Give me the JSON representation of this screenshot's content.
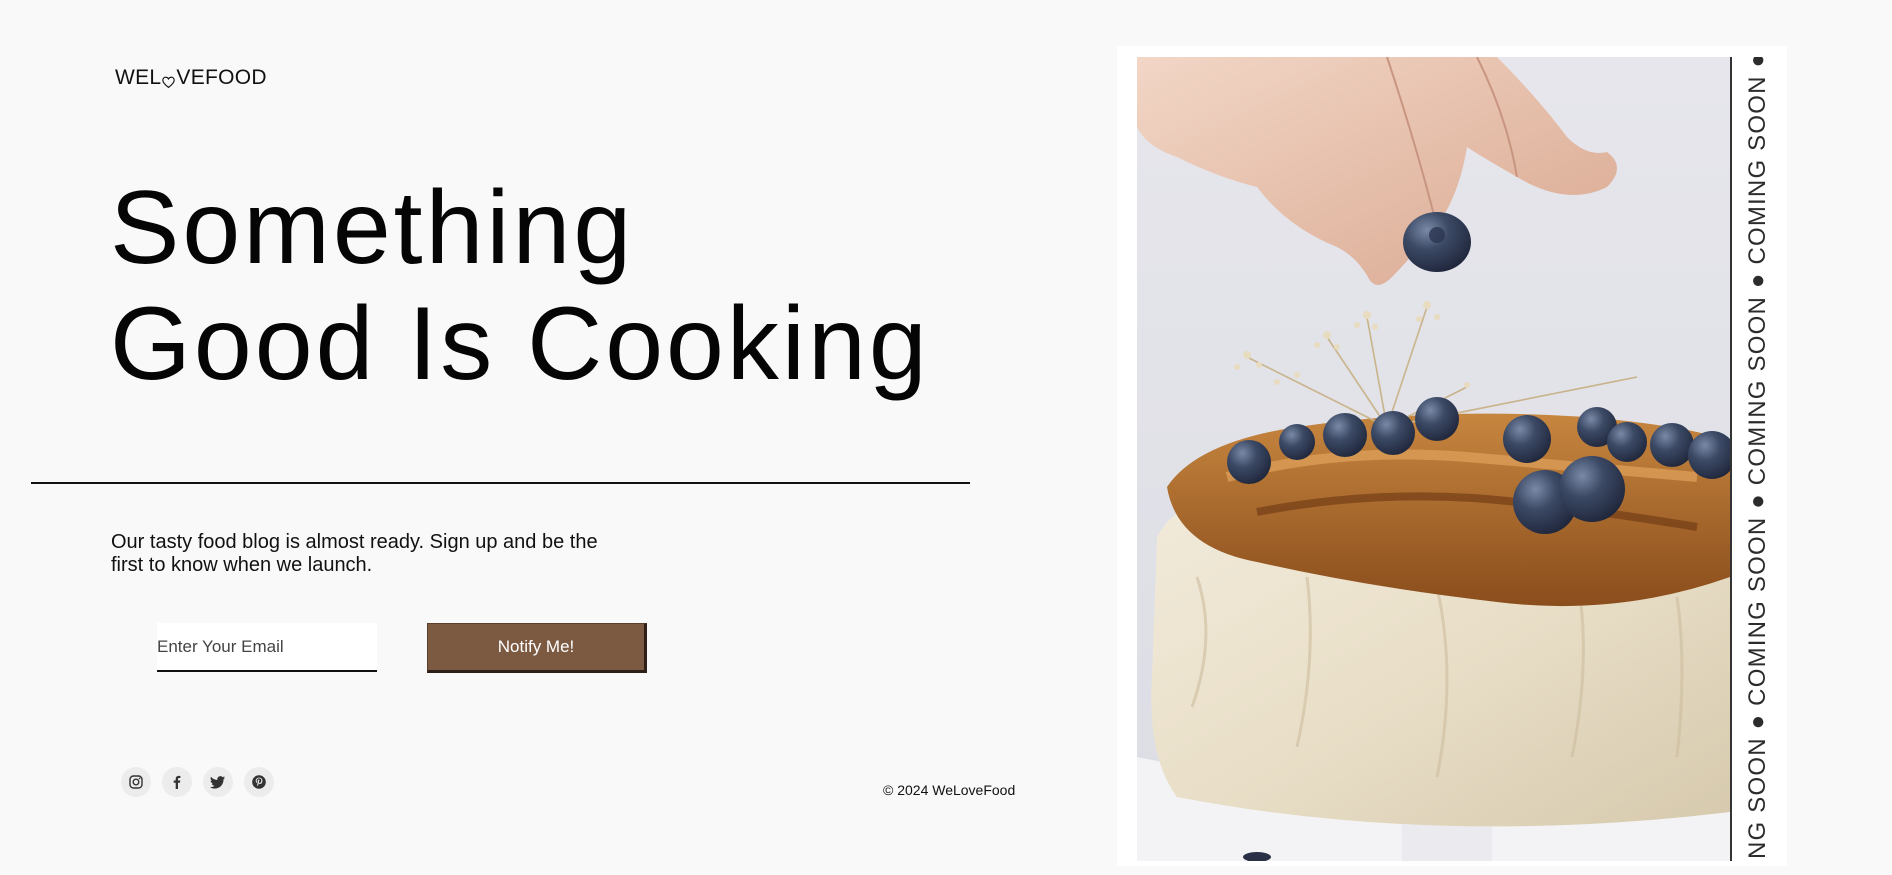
{
  "brand": {
    "logo_left": "WEL",
    "logo_right": "VEFOOD",
    "logo_icon": "heart-icon"
  },
  "hero": {
    "headline_line1": "Something",
    "headline_line2": "Good Is Cooking",
    "description": "Our tasty food blog is almost ready. Sign up and be the first to know when we launch."
  },
  "form": {
    "email_placeholder": "Enter Your Email",
    "email_value": "",
    "submit_label": "Notify Me!"
  },
  "social": [
    {
      "name": "instagram",
      "icon": "instagram-icon"
    },
    {
      "name": "facebook",
      "icon": "facebook-icon"
    },
    {
      "name": "twitter",
      "icon": "twitter-icon"
    },
    {
      "name": "pinterest",
      "icon": "pinterest-icon"
    }
  ],
  "footer": {
    "copyright": "© 2024 WeLoveFood"
  },
  "image_panel": {
    "ticker_text": "NG SOON ● COMING SOON ● COMING SOON ● COMING SOON ● COMING",
    "image_alt": "Hand placing a blueberry on a frosted cake"
  },
  "colors": {
    "background": "#f9f9f9",
    "accent": "#7c5a42",
    "text": "#111111"
  }
}
